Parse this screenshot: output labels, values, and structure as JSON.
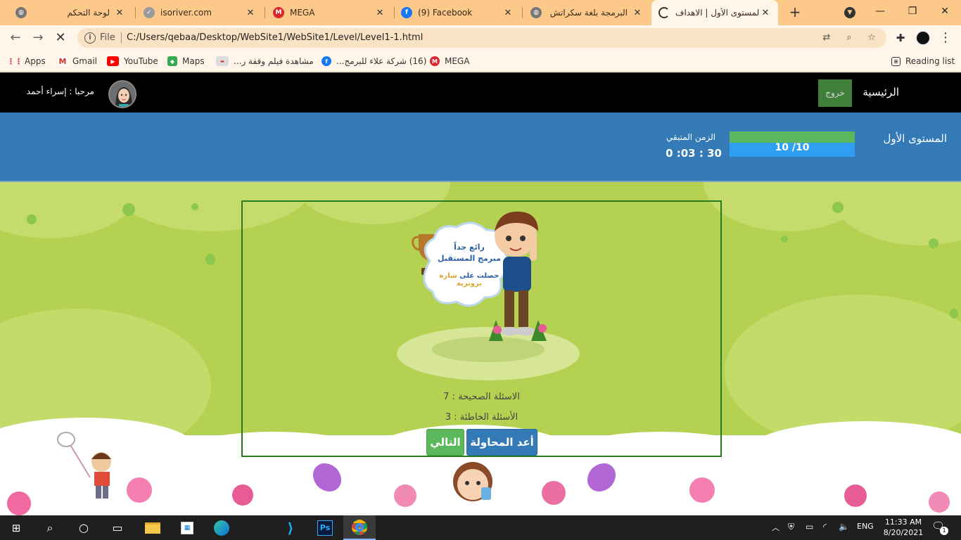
{
  "browser": {
    "tabs": [
      {
        "title": "لوحة التحكم",
        "favicon": "globe-icon"
      },
      {
        "title": "isoriver.com",
        "favicon": "check-icon"
      },
      {
        "title": "MEGA",
        "favicon": "mega-icon"
      },
      {
        "title": "(9) Facebook",
        "favicon": "facebook-icon"
      },
      {
        "title": "البرمجة بلغة سكراتش",
        "favicon": "globe-icon"
      },
      {
        "title": "المستوى الأول | الاهداف",
        "favicon": "loading-icon",
        "active": true
      }
    ],
    "address": {
      "scheme": "File",
      "url": "C:/Users/qebaa/Desktop/WebSite1/WebSite1/Level/Level1-1.html"
    },
    "bookmarks": [
      {
        "label": "Apps",
        "icon": "apps-grid-icon"
      },
      {
        "label": "Gmail",
        "icon": "gmail-icon"
      },
      {
        "label": "YouTube",
        "icon": "youtube-icon"
      },
      {
        "label": "Maps",
        "icon": "maps-icon"
      },
      {
        "label": "مشاهدة فيلم وقفة ر...",
        "icon": "site-icon"
      },
      {
        "label": "(16) شركة علاء للبرمج...",
        "icon": "facebook-icon"
      },
      {
        "label": "MEGA",
        "icon": "mega-icon"
      }
    ],
    "reading_list": "Reading list"
  },
  "site": {
    "nav": {
      "home": "الرئيسية",
      "logout": "خروج",
      "welcome": "مرحبا : إسراء أحمد"
    },
    "level": {
      "title": "المستوى الأول",
      "progress_text": "10 /10",
      "progress_fraction": 1.0,
      "timer_label": "الزمن المتبقي",
      "timer_value": "0 :03 : 30"
    },
    "result": {
      "correct": "الاسئلة الصحيحة : 7",
      "wrong": "الأسئلة الخاطئة : 3",
      "retry": "أعد المحاولة",
      "next": "التالي"
    }
  },
  "badge_image": {
    "line1": "رائع جداً",
    "line2": "مبرمج المستقبل",
    "line3a": "حصلت على",
    "line3b": "شارة برونزية"
  },
  "taskbar": {
    "lang": "ENG",
    "time": "11:33 AM",
    "date": "8/20/2021",
    "notifications": "1"
  },
  "colors": {
    "tab_bar": "#fcc98b",
    "nav_black": "#000000",
    "level_bar": "#337ab7",
    "progress_green": "#5cb85c",
    "progress_blue": "#2f9ff3",
    "scene_green": "#b5d151",
    "box_border": "#2a7a1e",
    "btn_retry": "#337ab7",
    "btn_next": "#5cb85c"
  }
}
